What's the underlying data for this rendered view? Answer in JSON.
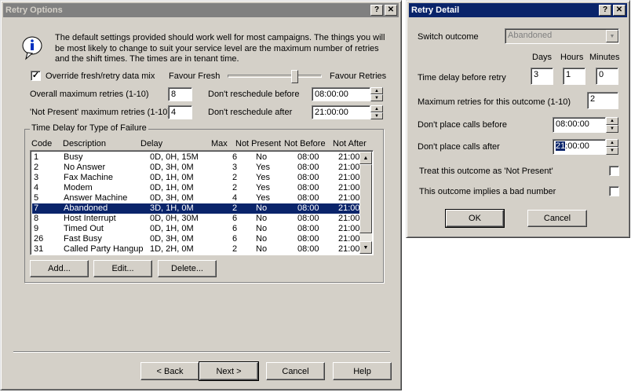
{
  "retry_options": {
    "title": "Retry Options",
    "help_btn": "?",
    "close_btn": "✕",
    "info_text": "The default settings provided should work well for most campaigns. The things you will be most likely to change to suit your service level are the maximum number of retries and the shift times. The times are in tenant time.",
    "override_label": "Override fresh/retry data mix",
    "override_checked": "✓",
    "favour_fresh": "Favour Fresh",
    "favour_retries": "Favour Retries",
    "slider_position": 0.73,
    "overall_max_label": "Overall maximum retries (1-10)",
    "overall_max_value": "8",
    "not_present_max_label": "'Not Present' maximum retries (1-10)",
    "not_present_max_value": "4",
    "dont_before_label": "Don't reschedule before",
    "dont_before_value": "08:00:00",
    "dont_after_label": "Don't reschedule after",
    "dont_after_value": "21:00:00",
    "group_title": "Time Delay for Type of Failure",
    "columns": {
      "code": "Code",
      "description": "Description",
      "delay": "Delay",
      "max": "Max",
      "not_present": "Not Present",
      "not_before": "Not Before",
      "not_after": "Not After"
    },
    "rows": [
      {
        "code": "1",
        "description": "Busy",
        "delay": "0D, 0H, 15M",
        "max": "6",
        "not_present": "No",
        "not_before": "08:00",
        "not_after": "21:00"
      },
      {
        "code": "2",
        "description": "No Answer",
        "delay": "0D, 3H, 0M",
        "max": "3",
        "not_present": "Yes",
        "not_before": "08:00",
        "not_after": "21:00"
      },
      {
        "code": "3",
        "description": "Fax Machine",
        "delay": "0D, 1H, 0M",
        "max": "2",
        "not_present": "Yes",
        "not_before": "08:00",
        "not_after": "21:00"
      },
      {
        "code": "4",
        "description": "Modem",
        "delay": "0D, 1H, 0M",
        "max": "2",
        "not_present": "Yes",
        "not_before": "08:00",
        "not_after": "21:00"
      },
      {
        "code": "5",
        "description": "Answer Machine",
        "delay": "0D, 3H, 0M",
        "max": "4",
        "not_present": "Yes",
        "not_before": "08:00",
        "not_after": "21:00"
      },
      {
        "code": "7",
        "description": "Abandoned",
        "delay": "3D, 1H, 0M",
        "max": "2",
        "not_present": "No",
        "not_before": "08:00",
        "not_after": "21:00"
      },
      {
        "code": "8",
        "description": "Host Interrupt",
        "delay": "0D, 0H, 30M",
        "max": "6",
        "not_present": "No",
        "not_before": "08:00",
        "not_after": "21:00"
      },
      {
        "code": "9",
        "description": "Timed Out",
        "delay": "0D, 1H, 0M",
        "max": "6",
        "not_present": "No",
        "not_before": "08:00",
        "not_after": "21:00"
      },
      {
        "code": "26",
        "description": "Fast Busy",
        "delay": "0D, 3H, 0M",
        "max": "6",
        "not_present": "No",
        "not_before": "08:00",
        "not_after": "21:00"
      },
      {
        "code": "31",
        "description": "Called Party Hangup",
        "delay": "1D, 2H, 0M",
        "max": "2",
        "not_present": "No",
        "not_before": "08:00",
        "not_after": "21:00"
      }
    ],
    "selected_row": 5,
    "add_btn": "Add...",
    "edit_btn": "Edit...",
    "delete_btn": "Delete...",
    "back_btn": "< Back",
    "next_btn": "Next >",
    "cancel_btn": "Cancel",
    "help_button": "Help"
  },
  "retry_detail": {
    "title": "Retry Detail",
    "help_btn": "?",
    "close_btn": "✕",
    "switch_label": "Switch outcome",
    "switch_value": "Abandoned",
    "days_label": "Days",
    "hours_label": "Hours",
    "minutes_label": "Minutes",
    "delay_label": "Time delay before retry",
    "days_value": "3",
    "hours_value": "1",
    "minutes_value": "0",
    "max_label": "Maximum retries for this outcome (1-10)",
    "max_value": "2",
    "before_label": "Don't place calls before",
    "before_value": "08:00:00",
    "after_label": "Don't place calls after",
    "after_value_sel": "21",
    "after_value_rest": ":00:00",
    "not_present_label": "Treat this outcome as 'Not Present'",
    "bad_number_label": "This outcome implies a bad number",
    "ok_btn": "OK",
    "cancel_btn": "Cancel"
  }
}
